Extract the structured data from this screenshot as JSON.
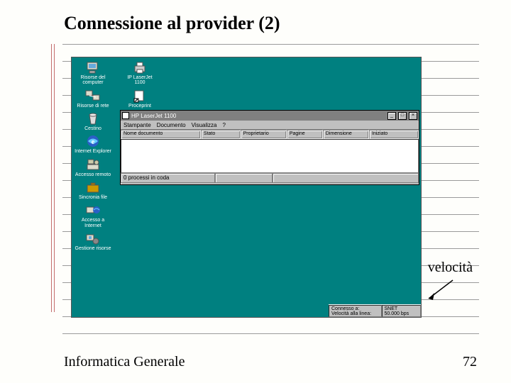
{
  "slide": {
    "title": "Connessione al provider (2)",
    "footer_left": "Informatica Generale",
    "footer_right": "72",
    "annotation": "velocità"
  },
  "desktop_icons": {
    "col1": [
      {
        "name": "my-computer",
        "label": "Risorse del computer"
      },
      {
        "name": "network",
        "label": "Risorse di rete"
      },
      {
        "name": "recycle-bin",
        "label": "Cestino"
      },
      {
        "name": "ie",
        "label": "Internet Explorer"
      },
      {
        "name": "dup",
        "label": "Accesso remoto"
      },
      {
        "name": "briefcase",
        "label": "Sincronia file"
      },
      {
        "name": "dun",
        "label": "Accesso a Internet"
      },
      {
        "name": "users",
        "label": "Gestione risorse"
      }
    ],
    "col2": [
      {
        "name": "printer",
        "label": "IP LaserJet 1100"
      },
      {
        "name": "shortcut",
        "label": "Proceprint"
      }
    ]
  },
  "window": {
    "title": "HP LaserJet 1100",
    "menu": [
      "Stampante",
      "Documento",
      "Visualizza",
      "?"
    ],
    "columns": [
      "Nome documento",
      "Stato",
      "Proprietario",
      "Pagine",
      "Dimensione",
      "Iniziato"
    ],
    "status": "0 processi in coda"
  },
  "tray": {
    "line1a": "Connesso a:",
    "line1b": "Velocità alla linea:",
    "line2a": "SNET",
    "line2b": "50.000 bps"
  }
}
